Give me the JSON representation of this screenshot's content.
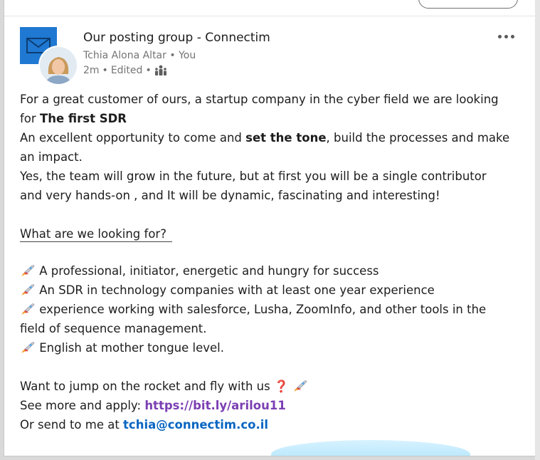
{
  "post": {
    "group_name": "Our posting group - Connectim",
    "author_name": "Tchia Alona Altar",
    "author_relation": "You",
    "time_ago": "2m",
    "edited_label": "Edited",
    "visibility_icon": "group-icon",
    "more_icon": "ellipsis-icon",
    "group_logo_icon": "envelope-icon"
  },
  "content": {
    "intro_1": "For a great customer of ours, a startup company in the cyber field we are looking",
    "intro_2_prefix": "for ",
    "intro_2_bold": "The first SDR",
    "opp_prefix": "An excellent opportunity to come and ",
    "opp_bold": "set the tone",
    "opp_suffix": ", build the processes and make",
    "opp_line2": "an impact.",
    "team_1": "Yes, the team will grow in the future, but at first you will be a single contributor",
    "team_2": "and very hands-on , and  It will be dynamic, fascinating and interesting!",
    "looking_heading": "What are we looking for?",
    "bullets": [
      "A professional, initiator, energetic and hungry for success",
      "An  SDR in technology companies with  at least one year experience",
      "experience working with salesforce, Lusha, ZoomInfo, and other tools in the",
      "English at mother tongue level."
    ],
    "bullet_3_cont": "field of sequence management.",
    "cta": "Want to jump on the rocket and fly with us",
    "cta_q": "❓",
    "apply_prefix": "See more and apply: ",
    "apply_link": "https://bit.ly/arilou11",
    "send_prefix": "Or send to me at ",
    "send_email": "tchia@connectim.co.il"
  },
  "colors": {
    "link_purple": "#7b3fb3",
    "link_blue": "#0a66c2",
    "group_logo_bg": "#1f78d1"
  }
}
